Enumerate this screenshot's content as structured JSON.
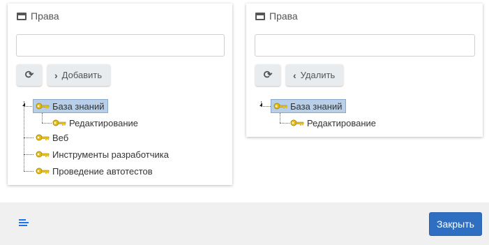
{
  "left_panel": {
    "title": "Права",
    "search_value": "",
    "action_label": "Добавить",
    "tree": [
      {
        "label": "База знаний",
        "selected": true
      },
      {
        "label": "Редактирование",
        "selected": false
      },
      {
        "label": "Веб",
        "selected": false
      },
      {
        "label": "Инструменты разработчика",
        "selected": false
      },
      {
        "label": "Проведение автотестов",
        "selected": false
      }
    ]
  },
  "right_panel": {
    "title": "Права",
    "search_value": "",
    "action_label": "Удалить",
    "tree": [
      {
        "label": "База знаний",
        "selected": true
      },
      {
        "label": "Редактирование",
        "selected": false
      }
    ]
  },
  "footer": {
    "close_label": "Закрыть"
  },
  "colors": {
    "accent": "#2f6fc2",
    "selection": "#b7cfe8",
    "key_icon": "#e8c21a"
  }
}
